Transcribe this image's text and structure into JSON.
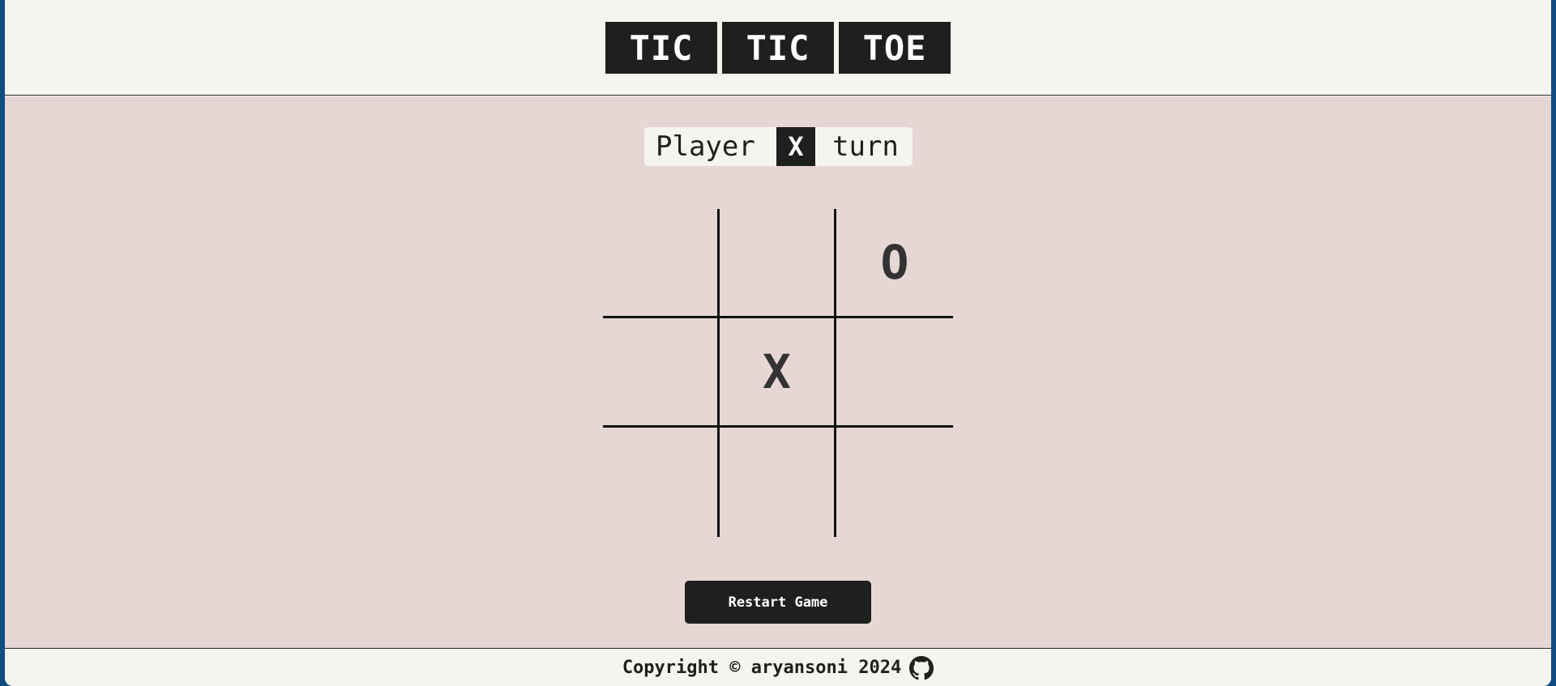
{
  "header": {
    "title_words": [
      "TIC",
      "TIC",
      "TOE"
    ]
  },
  "turn": {
    "prefix": "Player",
    "player": "X",
    "suffix": "turn"
  },
  "board": {
    "cells": [
      "",
      "",
      "O",
      "",
      "X",
      "",
      "",
      "",
      ""
    ]
  },
  "controls": {
    "restart_label": "Restart Game"
  },
  "footer": {
    "copyright": "Copyright © aryansoni 2024",
    "icon": "github-icon"
  },
  "colors": {
    "dark": "#1e201e",
    "header_bg": "#f5f4ef",
    "board_bg": "#e6d6d4",
    "outer_border": "#0f4c81"
  }
}
